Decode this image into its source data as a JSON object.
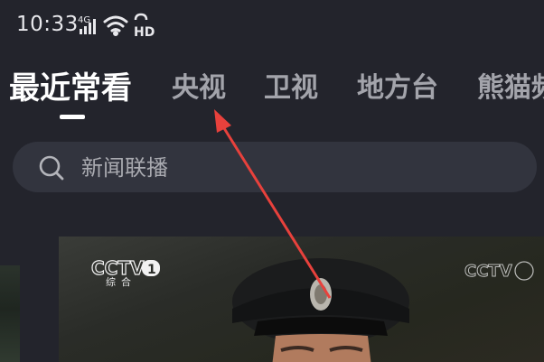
{
  "status_bar": {
    "time": "10:33",
    "network_label": "4G",
    "hd_label": "HD",
    "icons": [
      "cellular-signal-icon",
      "wifi-icon",
      "hd-voice-icon"
    ]
  },
  "tabs": [
    {
      "label": "最近常看",
      "active": true
    },
    {
      "label": "央视",
      "active": false
    },
    {
      "label": "卫视",
      "active": false
    },
    {
      "label": "地方台",
      "active": false
    },
    {
      "label": "熊猫频",
      "active": false
    }
  ],
  "search": {
    "placeholder": "新闻联播",
    "icon": "search-icon"
  },
  "channel_preview": {
    "logo_text": "CCTV",
    "channel_number": "1",
    "channel_sub": "综合",
    "right_logo_text": "CCTV"
  },
  "colors": {
    "background": "#23242c",
    "search_bg": "#32343e",
    "tab_inactive": "#a3a4ab",
    "tab_active": "#ffffff",
    "annotation_arrow": "#e8413c"
  }
}
